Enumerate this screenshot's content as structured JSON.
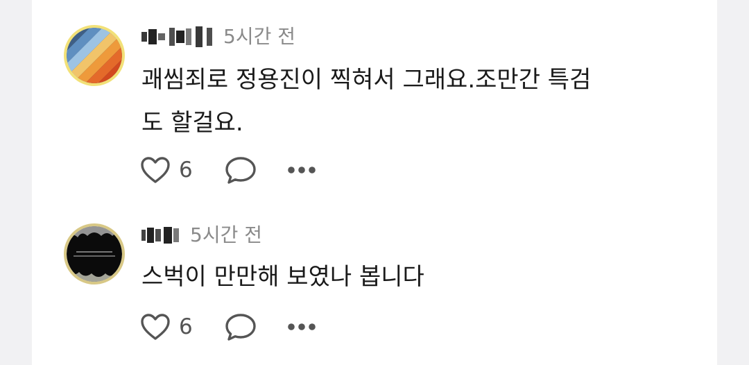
{
  "colors": {
    "page_background": "#f1f1f3",
    "card_background": "#ffffff",
    "text": "#1a1a1a",
    "muted": "#8a8a8a",
    "icon": "#555555"
  },
  "comments": [
    {
      "author_display": "blurred username",
      "avatar": "diagonal-stripes-avatar",
      "time": "5시간 전",
      "body": "괘씸죄로 정용진이 찍혀서 그래요.조만간 특검\n도 할걸요.",
      "likes": "6",
      "icons": {
        "like": "heart-outline-icon",
        "reply": "speech-bubble-icon",
        "more": "more-dots-icon"
      }
    },
    {
      "author_display": "blurred username",
      "avatar": "dark-photo-avatar",
      "time": "5시간 전",
      "body": "스벅이 만만해 보였나 봅니다",
      "likes": "6",
      "icons": {
        "like": "heart-outline-icon",
        "reply": "speech-bubble-icon",
        "more": "more-dots-icon"
      }
    }
  ]
}
